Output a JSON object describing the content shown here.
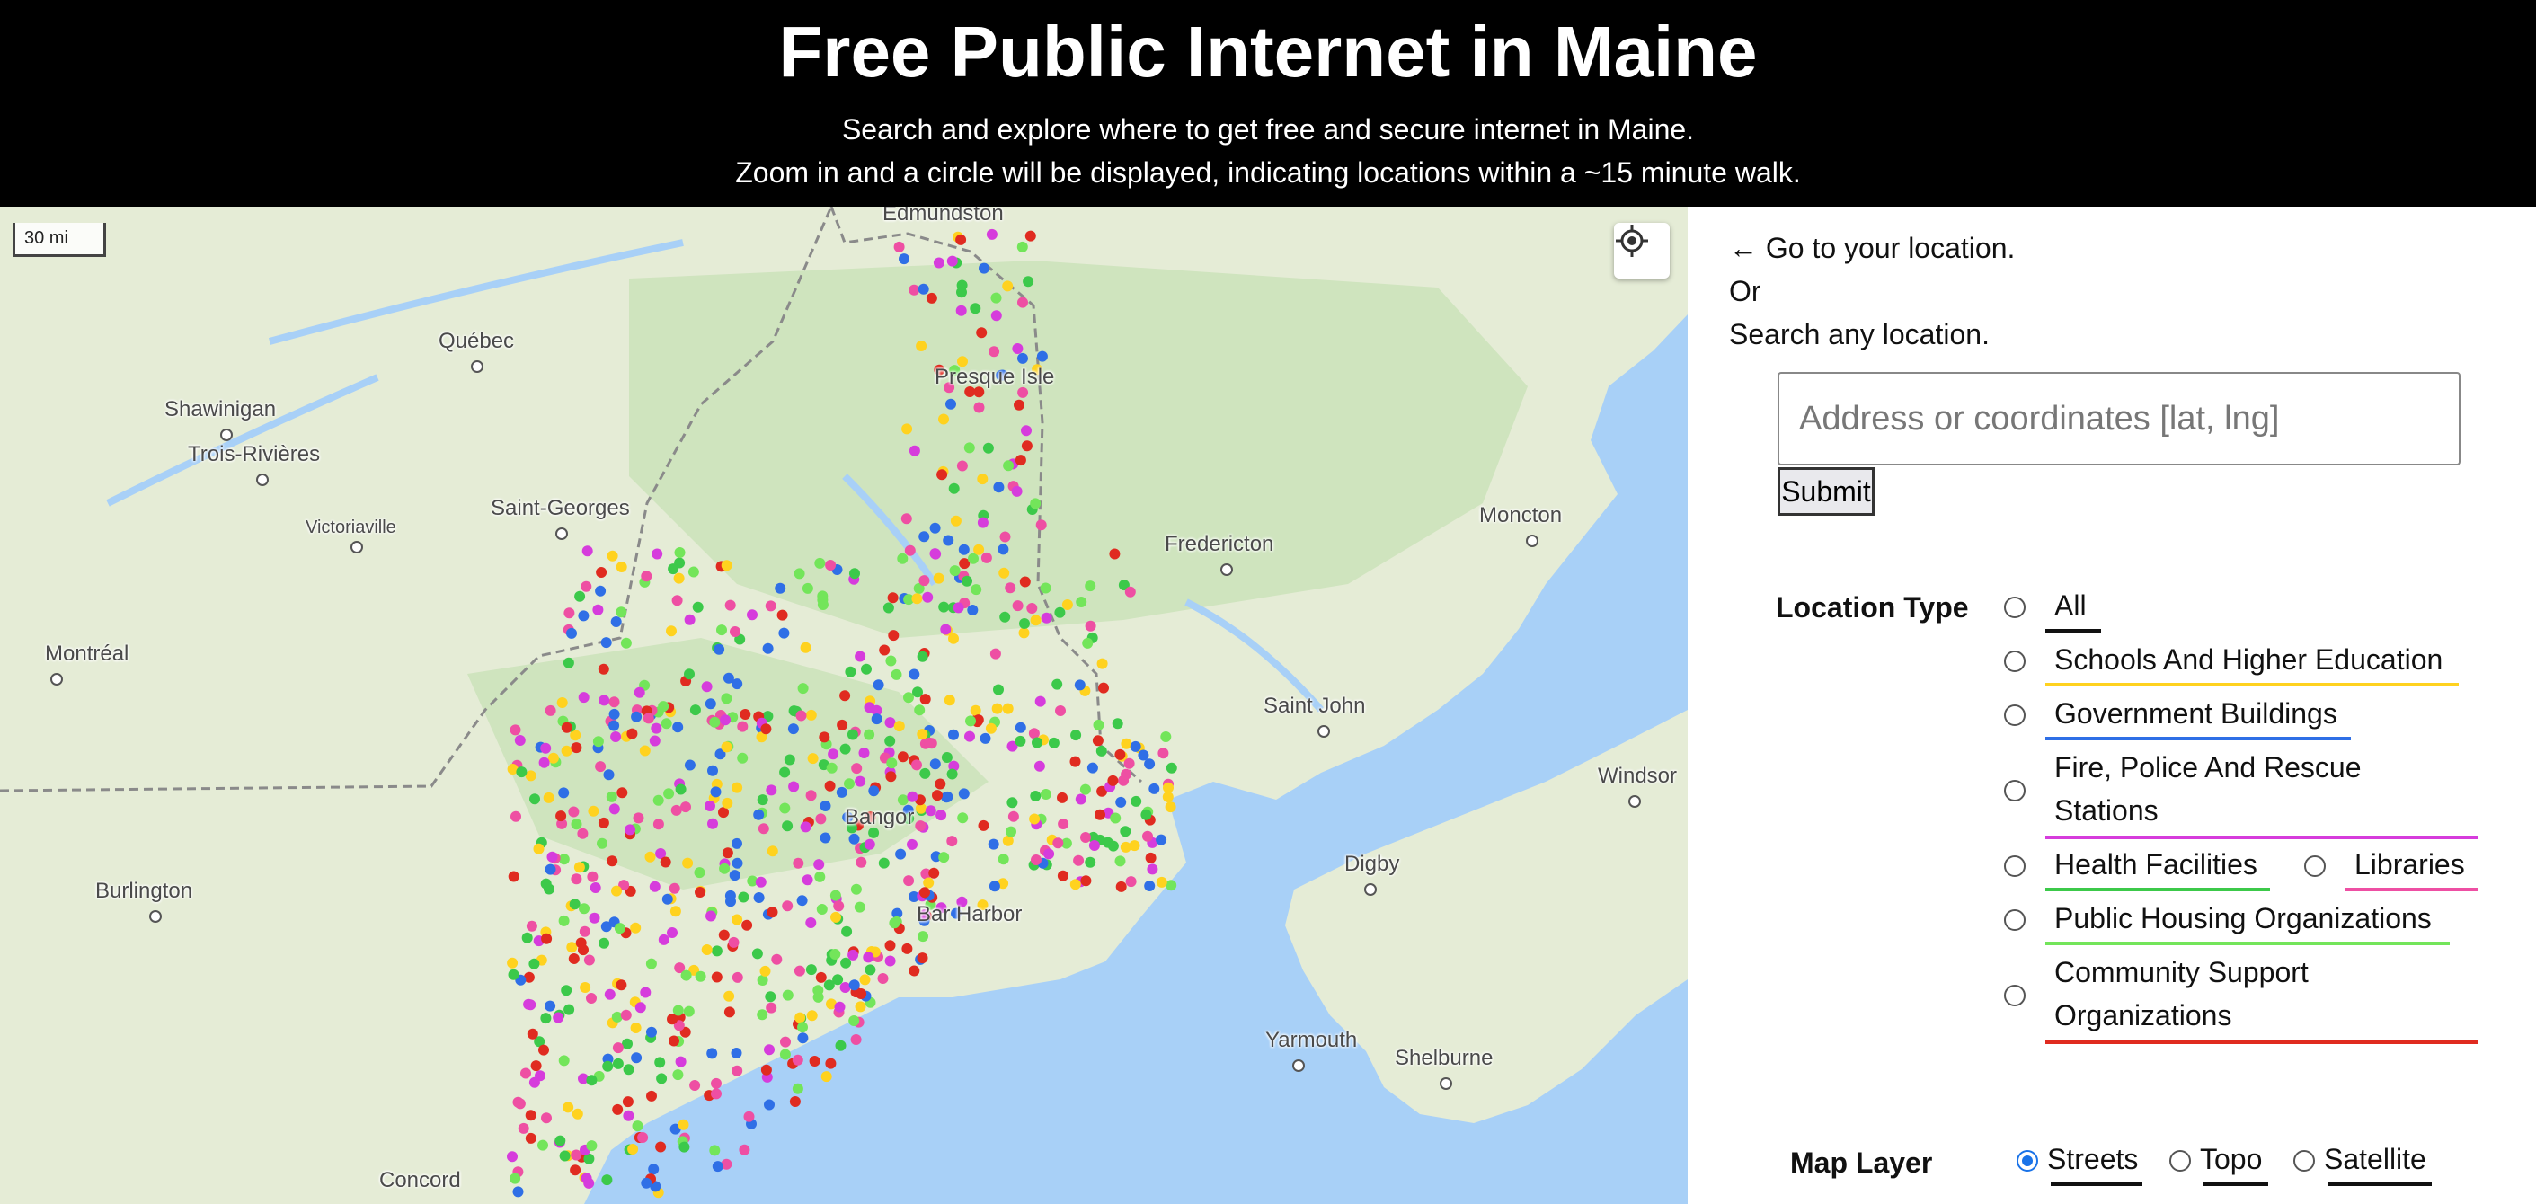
{
  "header": {
    "title": "Free Public Internet in Maine",
    "subtitle_line1": "Search and explore where to get free and secure internet in Maine.",
    "subtitle_line2": "Zoom in and a circle will be displayed, indicating locations within a ~15 minute walk."
  },
  "map": {
    "scale_label": "30 mi",
    "locate_icon": "crosshair-icon",
    "places": [
      {
        "name": "Edmundston",
        "dot": false
      },
      {
        "name": "Québec",
        "dot": true
      },
      {
        "name": "Shawinigan",
        "dot": true
      },
      {
        "name": "Trois-Rivières",
        "dot": true
      },
      {
        "name": "Victoriaville",
        "dot": true
      },
      {
        "name": "Saint-Georges",
        "dot": true
      },
      {
        "name": "Presque Isle",
        "dot": false
      },
      {
        "name": "Montréal",
        "dot": true
      },
      {
        "name": "Fredericton",
        "dot": true
      },
      {
        "name": "Moncton",
        "dot": true
      },
      {
        "name": "Saint John",
        "dot": true
      },
      {
        "name": "Windsor",
        "dot": true
      },
      {
        "name": "Bangor",
        "dot": false
      },
      {
        "name": "Digby",
        "dot": true
      },
      {
        "name": "Bar Harbor",
        "dot": false
      },
      {
        "name": "Burlington",
        "dot": true
      },
      {
        "name": "Yarmouth",
        "dot": true
      },
      {
        "name": "Shelburne",
        "dot": true
      },
      {
        "name": "Concord",
        "dot": true
      }
    ],
    "colors": {
      "water": "#a8d0f7",
      "land": "#e5ecd6",
      "forest": "#cfe4be",
      "border": "#8a8a8a",
      "schools": "#ffd21f",
      "government": "#2f6fe6",
      "fire_police": "#d63cdc",
      "health": "#3cc94a",
      "libraries": "#ee4fa3",
      "housing": "#73e55a",
      "community": "#e02b20"
    }
  },
  "panel": {
    "go_location": "← Go to your location.",
    "or": "Or",
    "search_any": "Search any location.",
    "search_placeholder": "Address or coordinates [lat, lng]",
    "submit_label": "Submit",
    "location_type_label": "Location Type",
    "location_types": [
      {
        "label": "All",
        "color": "#111111"
      },
      {
        "label": "Schools And Higher Education",
        "color": "#ffd21f"
      },
      {
        "label": "Government Buildings",
        "color": "#2f6fe6"
      },
      {
        "label": "Fire, Police And Rescue",
        "label2": "Stations",
        "color": "#d63cdc"
      },
      {
        "label": "Health Facilities",
        "color": "#3cc94a"
      },
      {
        "label": "Libraries",
        "color": "#ee4fa3"
      },
      {
        "label": "Public Housing Organizations",
        "color": "#73e55a"
      },
      {
        "label": "Community Support",
        "label2": "Organizations",
        "color": "#e02b20"
      }
    ],
    "map_layer_label": "Map Layer",
    "map_layers": [
      {
        "label": "Streets",
        "checked": true
      },
      {
        "label": "Topo",
        "checked": false
      },
      {
        "label": "Satellite",
        "checked": false
      }
    ]
  }
}
